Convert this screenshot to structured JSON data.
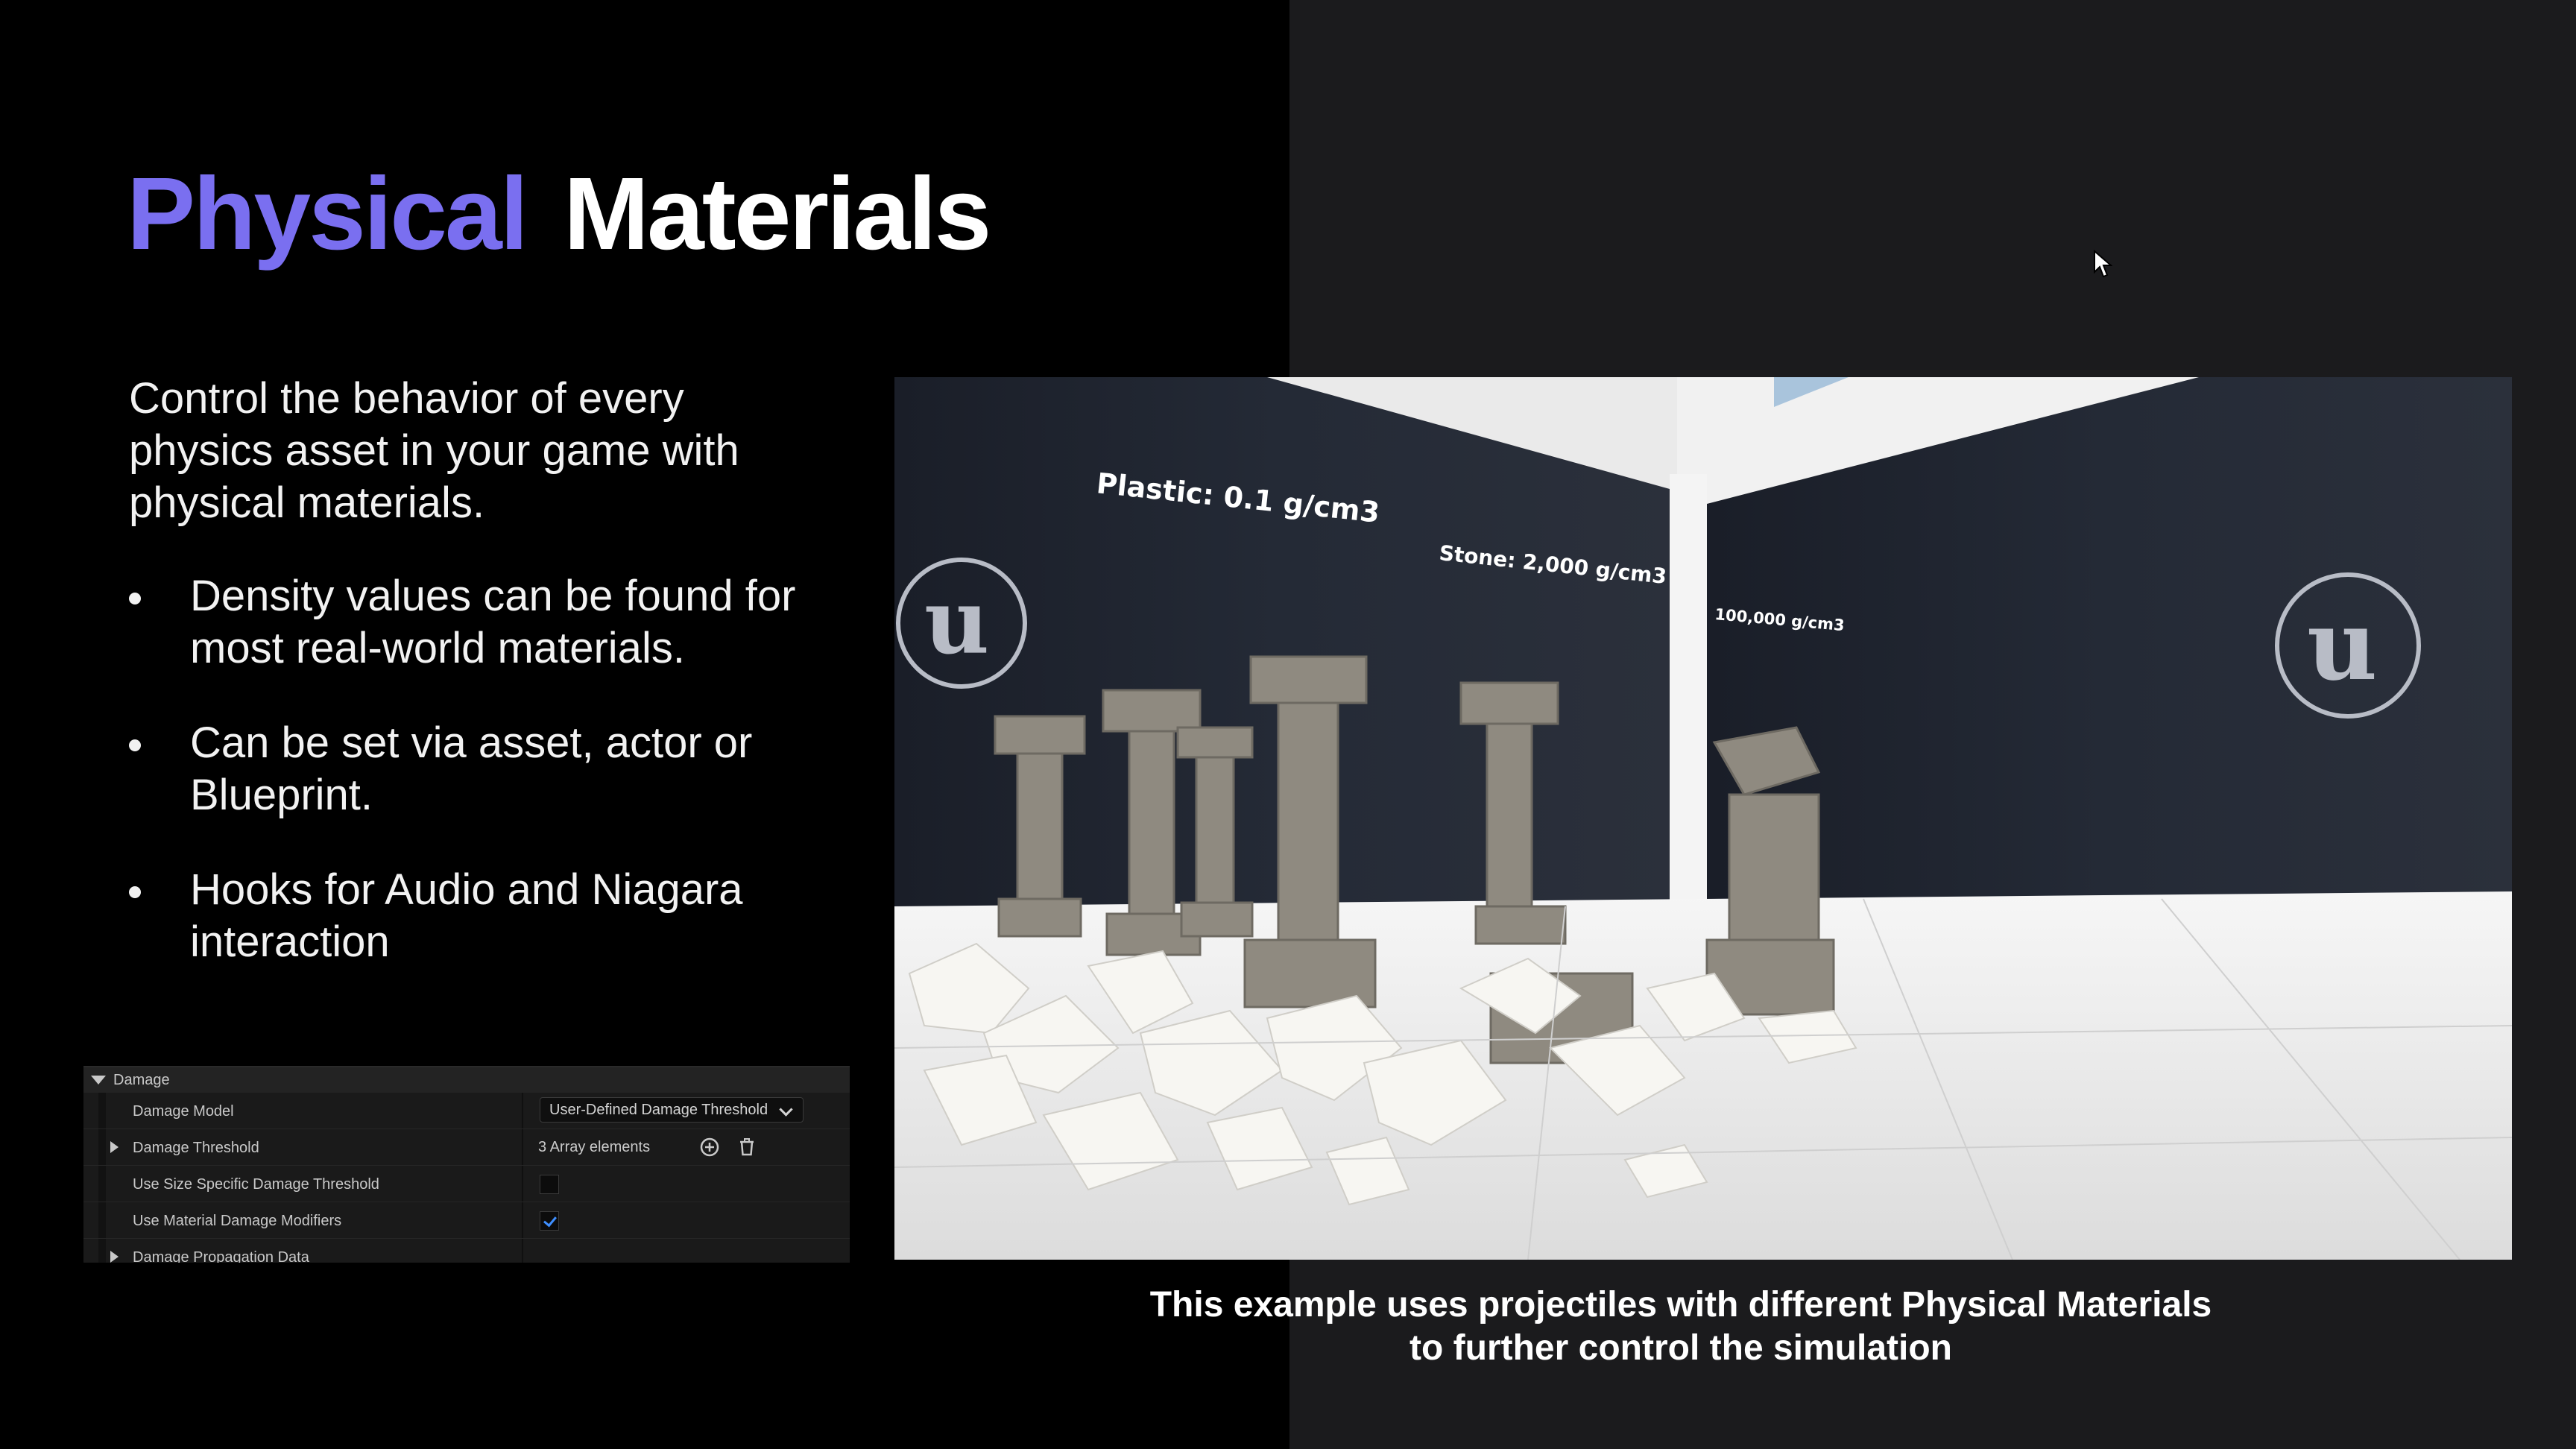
{
  "slide": {
    "title_part1": "Physical",
    "title_part2": "Materials",
    "intro": "Control the behavior of every physics asset in your game with physical materials.",
    "bullets": [
      "Density values can be found for most real-world materials.",
      "Can be set via asset, actor or Blueprint.",
      "Hooks for Audio and Niagara interaction"
    ],
    "caption_line1": "This example uses projectiles with different Physical Materials",
    "caption_line2": "to further control the simulation"
  },
  "panel": {
    "header": "Damage",
    "rows": [
      {
        "label": "Damage Model",
        "value": "User-Defined Damage Threshold"
      },
      {
        "label": "Damage Threshold",
        "value": "3 Array elements"
      },
      {
        "label": "Use Size Specific Damage Threshold",
        "checked": false
      },
      {
        "label": "Use Material Damage Modifiers",
        "checked": true
      },
      {
        "label": "Damage Propagation Data"
      }
    ]
  },
  "scene": {
    "wall_label_plastic": "Plastic: 0.1 g/cm3",
    "wall_label_stone": "Stone: 2,000 g/cm3",
    "wall_label_third": "100,000 g/cm3"
  },
  "colors": {
    "accent": "#7a6ff0",
    "right_background": "#1b1b1d",
    "checkbox_check": "#3f8fff"
  }
}
